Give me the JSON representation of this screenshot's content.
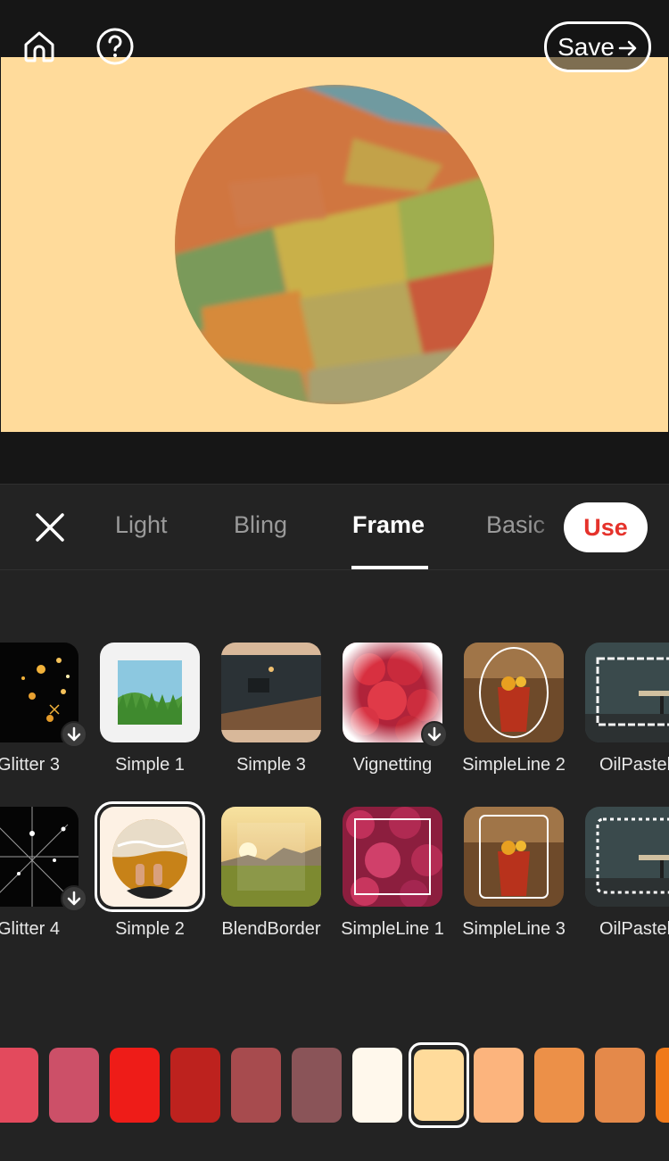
{
  "header": {
    "save_label": "Save"
  },
  "tabs": [
    {
      "label": "Light"
    },
    {
      "label": "Bling"
    },
    {
      "label": "Frame",
      "active": true
    },
    {
      "label": "Basic"
    }
  ],
  "use_label": "Use",
  "frames_row1": [
    {
      "label": "Glitter 3",
      "download": true
    },
    {
      "label": "Simple 1"
    },
    {
      "label": "Simple 3"
    },
    {
      "label": "Vignetting",
      "download": true
    },
    {
      "label": "SimpleLine 2"
    },
    {
      "label": "OilPastel"
    }
  ],
  "frames_row2": [
    {
      "label": "Glitter 4",
      "download": true
    },
    {
      "label": "Simple 2",
      "selected": true
    },
    {
      "label": "BlendBorder"
    },
    {
      "label": "SimpleLine 1"
    },
    {
      "label": "SimpleLine 3"
    },
    {
      "label": "OilPastel"
    }
  ],
  "colors": {
    "background": "#ffdb9b",
    "swatches": [
      "#e34a5d",
      "#cc5068",
      "#ee1c18",
      "#bd221e",
      "#a74b4e",
      "#8a5458",
      "#fff8ec",
      "#ffdb9b",
      "#fcb47d",
      "#ec9048",
      "#e4894a",
      "#f07a1a"
    ],
    "selected_swatch": "#ffdb9b",
    "accent": "#e5322b"
  }
}
